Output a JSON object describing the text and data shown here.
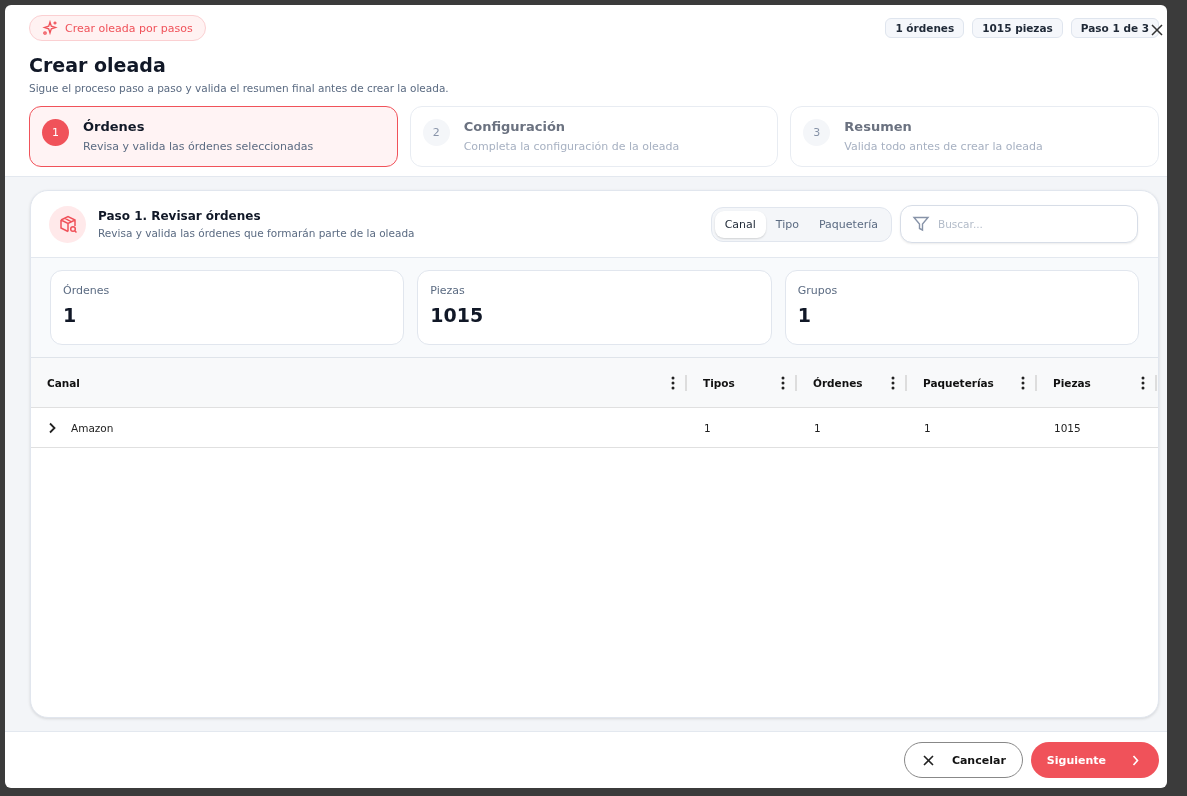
{
  "badge": {
    "label": "Crear oleada por pasos"
  },
  "chips": [
    "1 órdenes",
    "1015 piezas",
    "Paso 1 de 3"
  ],
  "title": "Crear oleada",
  "subtitle": "Sigue el proceso paso a paso y valida el resumen final antes de crear la oleada.",
  "steps": [
    {
      "number": "1",
      "title": "Órdenes",
      "description": "Revisa y valida las órdenes seleccionadas",
      "selected": true
    },
    {
      "number": "2",
      "title": "Configuración",
      "description": "Completa la configuración de la oleada",
      "selected": false
    },
    {
      "number": "3",
      "title": "Resumen",
      "description": "Valida todo antes de crear la oleada",
      "selected": false
    }
  ],
  "panel": {
    "title": "Paso 1. Revisar órdenes",
    "description": "Revisa y valida las órdenes que formarán parte de la oleada"
  },
  "group_tabs": [
    {
      "label": "Canal",
      "selected": true
    },
    {
      "label": "Tipo",
      "selected": false
    },
    {
      "label": "Paquetería",
      "selected": false
    }
  ],
  "search": {
    "placeholder": "Buscar..."
  },
  "stats": [
    {
      "label": "Órdenes",
      "value": "1"
    },
    {
      "label": "Piezas",
      "value": "1015"
    },
    {
      "label": "Grupos",
      "value": "1"
    }
  ],
  "table": {
    "columns": [
      "Canal",
      "Tipos",
      "Órdenes",
      "Paqueterías",
      "Piezas"
    ],
    "rows": [
      {
        "expanded": false,
        "cells": [
          "Amazon",
          "1",
          "1",
          "1",
          "1015"
        ]
      }
    ]
  },
  "buttons": {
    "cancel": "Cancelar",
    "next": "Siguiente"
  }
}
